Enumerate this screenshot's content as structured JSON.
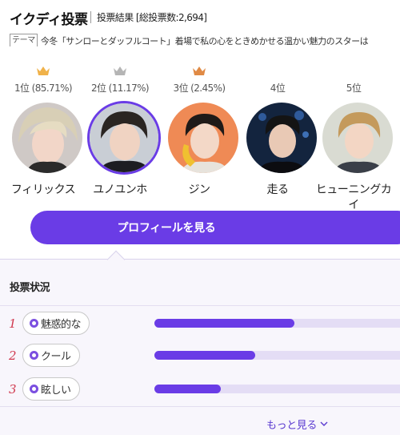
{
  "header": {
    "title": "イクディ投票",
    "result": "投票結果 [総投票数:2,694]",
    "theme_tag": "テーマ",
    "theme_text": "今冬「サンローとダッフルコート」着場で私の心をときめかせる温かい魅力のスターは"
  },
  "candidates": [
    {
      "rank": "1位 (85.71%)",
      "name": "フィリックス",
      "crown": "gold",
      "selected": false
    },
    {
      "rank": "2位 (11.17%)",
      "name": "ユノユンホ",
      "crown": "silver",
      "selected": true
    },
    {
      "rank": "3位 (2.45%)",
      "name": "ジン",
      "crown": "bronze",
      "selected": false
    },
    {
      "rank": "4位",
      "name": "走る",
      "crown": "none",
      "selected": false
    },
    {
      "rank": "5位",
      "name": "ヒューニングカイ",
      "crown": "none",
      "selected": false
    }
  ],
  "profile_button": "プロフィールを見る",
  "status": {
    "title": "投票状況",
    "items": [
      {
        "num": "1",
        "label": "魅惑的な",
        "fraction": 0.57
      },
      {
        "num": "2",
        "label": "クール",
        "fraction": 0.41
      },
      {
        "num": "3",
        "label": "眩しい",
        "fraction": 0.27
      }
    ],
    "more": "もっと見る"
  },
  "colors": {
    "accent": "#6a3ce6",
    "gold": "#f0b24a",
    "silver": "#b5b5b5",
    "bronze": "#e08a45",
    "rank_num": "#d0384e"
  }
}
